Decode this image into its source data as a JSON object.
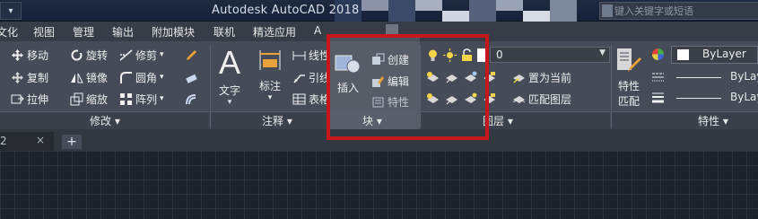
{
  "titlebar": {
    "title": "Autodesk AutoCAD 2018",
    "search_placeholder": "键入关键字或短语"
  },
  "menu": {
    "tabs": [
      {
        "label": "文化",
        "partial": true
      },
      {
        "label": "视图"
      },
      {
        "label": "管理"
      },
      {
        "label": "输出"
      },
      {
        "label": "附加模块"
      },
      {
        "label": "联机"
      },
      {
        "label": "精选应用"
      },
      {
        "label": "A"
      }
    ]
  },
  "modify_panel": {
    "title": "修改",
    "tools": [
      {
        "label": "移动",
        "icon": "move-icon"
      },
      {
        "label": "旋转",
        "icon": "rotate-icon"
      },
      {
        "label": "修剪",
        "icon": "trim-icon"
      },
      {
        "label": "复制",
        "icon": "copy-icon"
      },
      {
        "label": "镜像",
        "icon": "mirror-icon"
      },
      {
        "label": "圆角",
        "icon": "fillet-icon"
      },
      {
        "label": "拉伸",
        "icon": "stretch-icon"
      },
      {
        "label": "缩放",
        "icon": "scale-icon"
      },
      {
        "label": "阵列",
        "icon": "array-icon"
      }
    ]
  },
  "annotation_panel": {
    "title": "注释",
    "text_label": "文字",
    "dimension_label": "标注",
    "line_label": "线性",
    "leader_label": "引线",
    "table_label": "表格"
  },
  "block_panel": {
    "title": "块",
    "insert_label": "插入",
    "create_label": "创建",
    "edit_label": "编辑",
    "attributes_label": "特性"
  },
  "layers_panel": {
    "title": "图层",
    "layer_value": "0",
    "set_current_label": "置为当前",
    "match_layer_label": "匹配图层"
  },
  "properties_panel": {
    "title": "特性",
    "match_label": "特性",
    "match_label2": "匹配",
    "color_value": "ByLayer",
    "linetype_value": "ByLayer",
    "lineweight_value": "ByLayer"
  },
  "filetabs": {
    "doc_tab_label": "2",
    "close_glyph": "×",
    "add_glyph": "+"
  },
  "colors": {
    "highlight": "#c8161d",
    "ribbon": "#464c57",
    "drawing_bg": "#1c222b"
  }
}
